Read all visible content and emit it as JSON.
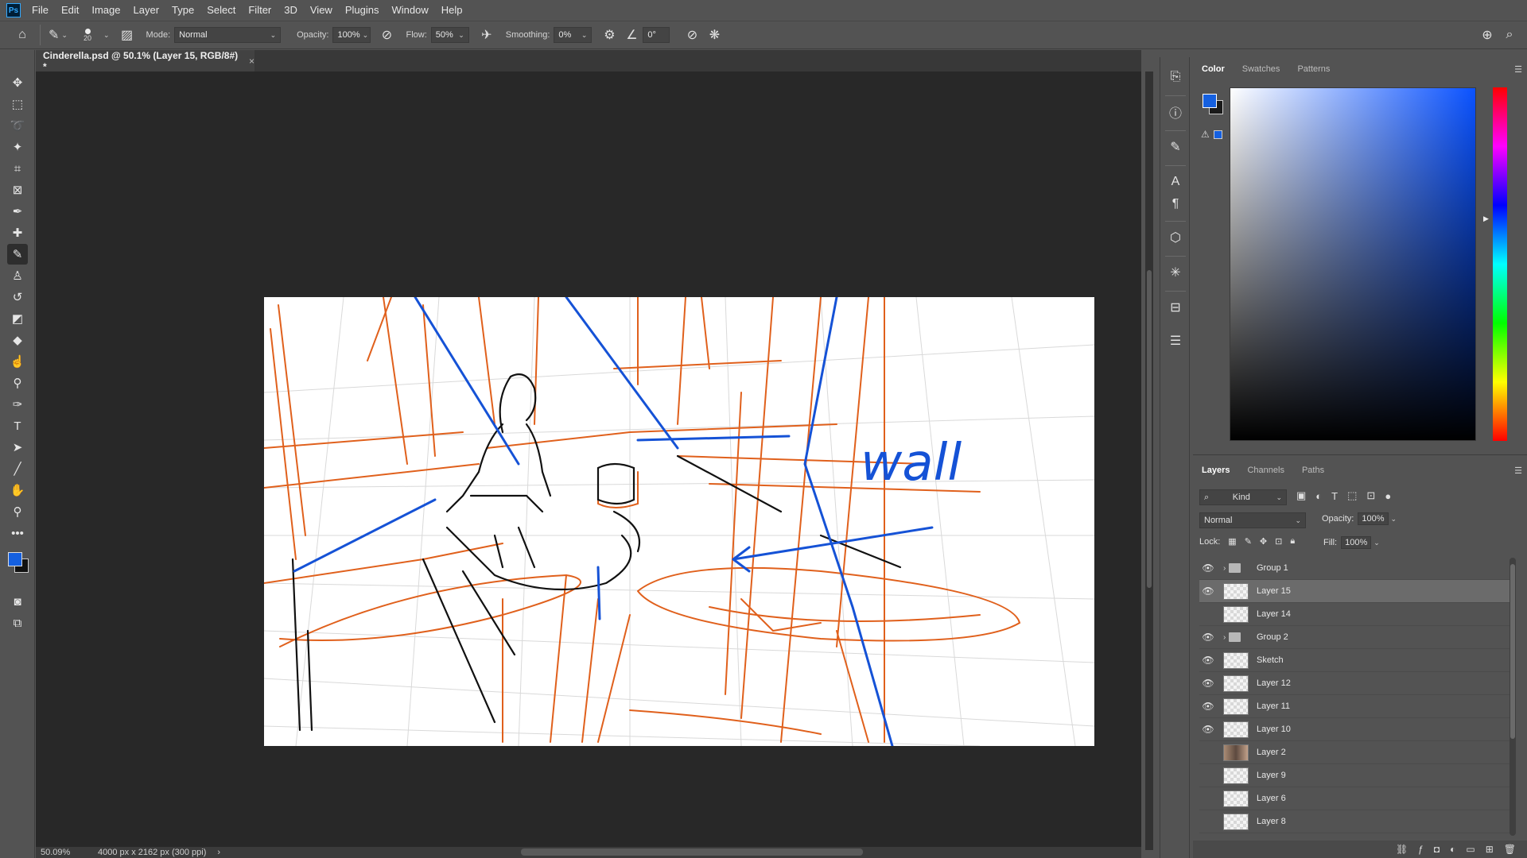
{
  "app": {
    "logo": "Ps",
    "menu": [
      "File",
      "Edit",
      "Image",
      "Layer",
      "Type",
      "Select",
      "Filter",
      "3D",
      "View",
      "Plugins",
      "Window",
      "Help"
    ]
  },
  "options": {
    "brush_size": "20",
    "mode_label": "Mode:",
    "mode_value": "Normal",
    "opacity_label": "Opacity:",
    "opacity_value": "100%",
    "flow_label": "Flow:",
    "flow_value": "50%",
    "smoothing_label": "Smoothing:",
    "smoothing_value": "0%",
    "angle_value": "0°"
  },
  "document": {
    "tab_title": "Cinderella.psd @ 50.1% (Layer 15, RGB/8#) *",
    "close": "×"
  },
  "canvas": {
    "annotation_text": "wall"
  },
  "status": {
    "zoom": "50.09%",
    "doc_info": "4000 px x 2162 px (300 ppi)",
    "arrow": "›"
  },
  "color_panel": {
    "tabs": [
      "Color",
      "Swatches",
      "Patterns"
    ],
    "foreground": "#1560e0",
    "background": "#1a1a1a"
  },
  "layers_panel": {
    "tabs": [
      "Layers",
      "Channels",
      "Paths"
    ],
    "filter_kind": "Kind",
    "blend_mode": "Normal",
    "opacity_label": "Opacity:",
    "opacity_value": "100%",
    "lock_label": "Lock:",
    "fill_label": "Fill:",
    "fill_value": "100%",
    "layers": [
      {
        "name": "Group 1",
        "visible": true,
        "type": "group",
        "selected": false
      },
      {
        "name": "Layer 15",
        "visible": true,
        "type": "layer",
        "selected": true
      },
      {
        "name": "Layer 14",
        "visible": false,
        "type": "layer",
        "selected": false
      },
      {
        "name": "Group 2",
        "visible": true,
        "type": "group",
        "selected": false
      },
      {
        "name": "Sketch",
        "visible": true,
        "type": "layer",
        "selected": false
      },
      {
        "name": "Layer 12",
        "visible": true,
        "type": "layer",
        "selected": false
      },
      {
        "name": "Layer 11",
        "visible": true,
        "type": "layer",
        "selected": false
      },
      {
        "name": "Layer 10",
        "visible": true,
        "type": "layer",
        "selected": false
      },
      {
        "name": "Layer 2",
        "visible": false,
        "type": "photo",
        "selected": false
      },
      {
        "name": "Layer 9",
        "visible": false,
        "type": "layer",
        "selected": false
      },
      {
        "name": "Layer 6",
        "visible": false,
        "type": "layer",
        "selected": false
      },
      {
        "name": "Layer 8",
        "visible": false,
        "type": "layer",
        "selected": false
      }
    ]
  }
}
